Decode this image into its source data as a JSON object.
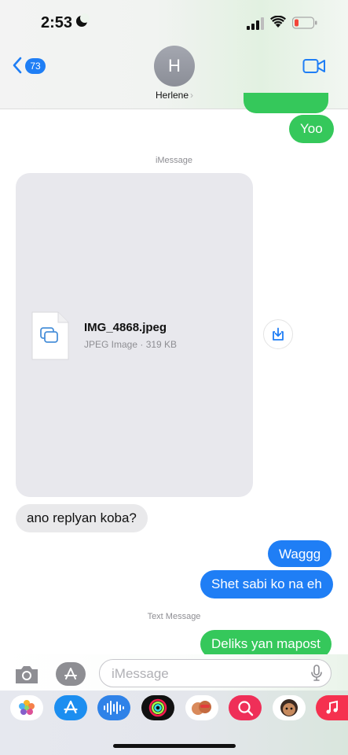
{
  "status_bar": {
    "time": "2:53"
  },
  "header": {
    "back_count": "73",
    "avatar_initial": "H",
    "contact_name": "Herlene",
    "contact_chevron": "›"
  },
  "messages": {
    "msg1": "Yoo",
    "label_imessage": "iMessage",
    "attachment": {
      "file_name": "IMG_4868.jpeg",
      "file_meta": "JPEG Image · 319 KB"
    },
    "msg2": "ano replyan koba?",
    "msg3": "Waggg",
    "msg4": "Shet sabi ko na eh",
    "label_text": "Text Message",
    "msg5": "Deliks yan mapost"
  },
  "input": {
    "placeholder": "iMessage"
  },
  "app_drawer": [
    "photos-icon",
    "app-store-icon",
    "audio-message-icon",
    "fitness-rings-icon",
    "memoji-icon",
    "search-images-icon",
    "memoji-stickers-icon",
    "music-icon"
  ],
  "colors": {
    "imessage_blue": "#1f7ef5",
    "sms_green": "#35c85b",
    "received_gray": "#e9e9eb"
  }
}
